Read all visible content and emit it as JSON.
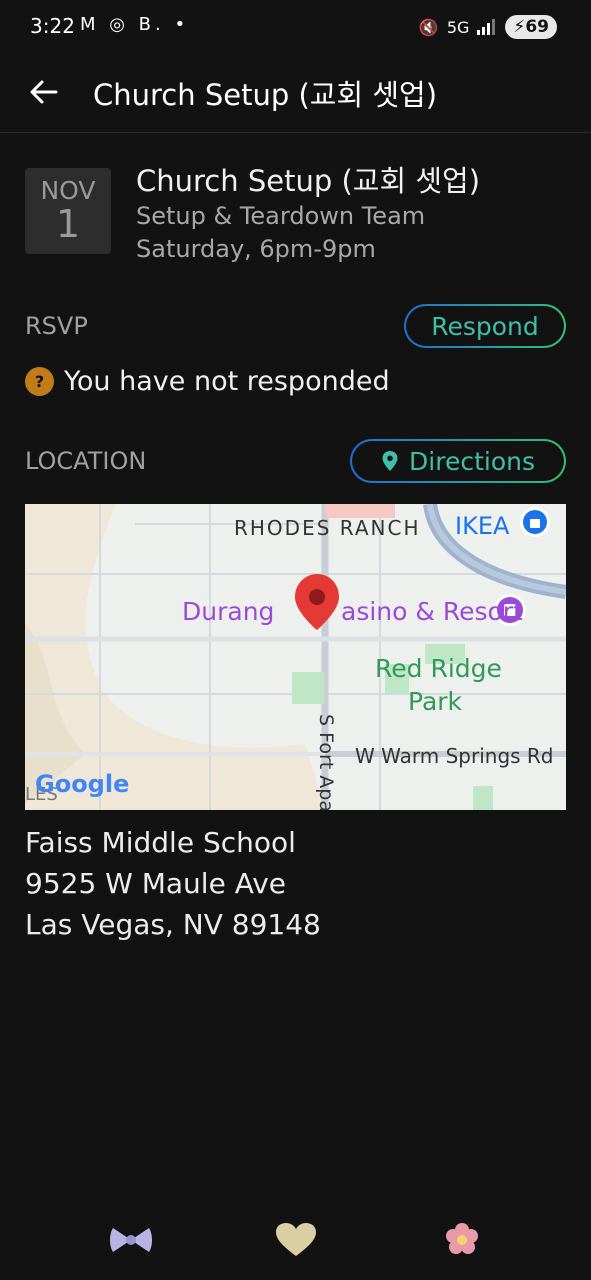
{
  "status_bar": {
    "time": "3:22",
    "left_icons": [
      "gmail-icon",
      "instagram-icon",
      "b-app-icon",
      "dot-icon"
    ],
    "left_glyphs": "M ◎ B. •",
    "network": "5G",
    "battery": "69"
  },
  "app_bar": {
    "title": "Church Setup (교회 셋업)"
  },
  "event": {
    "month": "NOV",
    "day": "1",
    "title": "Church Setup (교회 셋업)",
    "team": "Setup & Teardown Team",
    "time": "Saturday, 6pm-9pm"
  },
  "rsvp": {
    "label": "RSVP",
    "button": "Respond",
    "status_icon": "?",
    "status_text": "You have not responded"
  },
  "location": {
    "label": "LOCATION",
    "button": "Directions",
    "map": {
      "labels": {
        "rhodes": "RHODES RANCH",
        "ikea": "IKEA",
        "casino_a": "Durang",
        "casino_b": "asino & Resort",
        "park_1": "Red Ridge",
        "park_2": "Park",
        "fort": "S Fort Apa",
        "warm": "W Warm Springs Rd",
        "google": "Google",
        "edge": "LES"
      }
    },
    "address": {
      "line1": "Faiss Middle School",
      "line2": "9525 W Maule Ave",
      "line3": "Las Vegas, NV 89148"
    }
  },
  "bottom_icons": [
    "bow-icon",
    "heart-icon",
    "flower-icon"
  ],
  "colors": {
    "background": "#121212",
    "accent_teal": "#3fbfa8",
    "rsvp_badge": "#c27b18",
    "map_pin": "#e53935",
    "casino_purple": "#9c4ad6",
    "park_green": "#2f9a5a"
  }
}
